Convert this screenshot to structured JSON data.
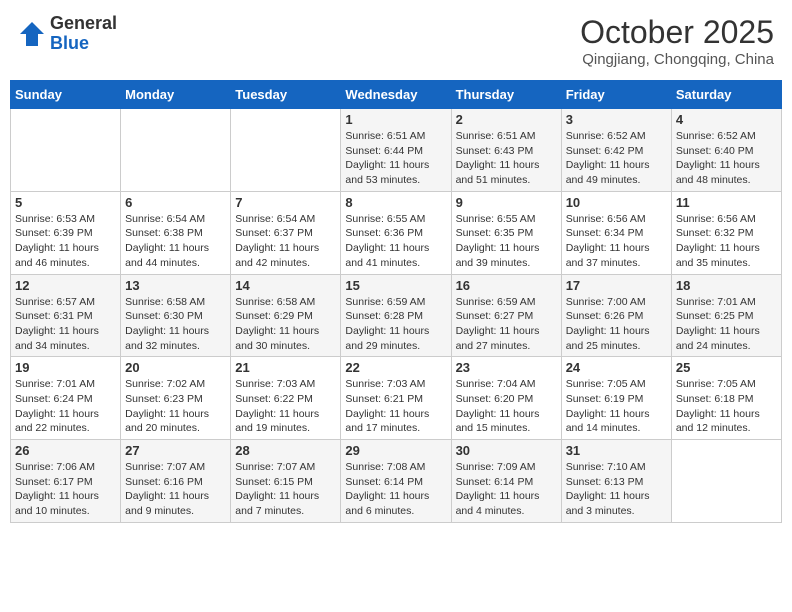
{
  "logo": {
    "general": "General",
    "blue": "Blue"
  },
  "header": {
    "title": "October 2025",
    "subtitle": "Qingjiang, Chongqing, China"
  },
  "weekdays": [
    "Sunday",
    "Monday",
    "Tuesday",
    "Wednesday",
    "Thursday",
    "Friday",
    "Saturday"
  ],
  "weeks": [
    [
      {
        "day": "",
        "info": ""
      },
      {
        "day": "",
        "info": ""
      },
      {
        "day": "",
        "info": ""
      },
      {
        "day": "1",
        "info": "Sunrise: 6:51 AM\nSunset: 6:44 PM\nDaylight: 11 hours\nand 53 minutes."
      },
      {
        "day": "2",
        "info": "Sunrise: 6:51 AM\nSunset: 6:43 PM\nDaylight: 11 hours\nand 51 minutes."
      },
      {
        "day": "3",
        "info": "Sunrise: 6:52 AM\nSunset: 6:42 PM\nDaylight: 11 hours\nand 49 minutes."
      },
      {
        "day": "4",
        "info": "Sunrise: 6:52 AM\nSunset: 6:40 PM\nDaylight: 11 hours\nand 48 minutes."
      }
    ],
    [
      {
        "day": "5",
        "info": "Sunrise: 6:53 AM\nSunset: 6:39 PM\nDaylight: 11 hours\nand 46 minutes."
      },
      {
        "day": "6",
        "info": "Sunrise: 6:54 AM\nSunset: 6:38 PM\nDaylight: 11 hours\nand 44 minutes."
      },
      {
        "day": "7",
        "info": "Sunrise: 6:54 AM\nSunset: 6:37 PM\nDaylight: 11 hours\nand 42 minutes."
      },
      {
        "day": "8",
        "info": "Sunrise: 6:55 AM\nSunset: 6:36 PM\nDaylight: 11 hours\nand 41 minutes."
      },
      {
        "day": "9",
        "info": "Sunrise: 6:55 AM\nSunset: 6:35 PM\nDaylight: 11 hours\nand 39 minutes."
      },
      {
        "day": "10",
        "info": "Sunrise: 6:56 AM\nSunset: 6:34 PM\nDaylight: 11 hours\nand 37 minutes."
      },
      {
        "day": "11",
        "info": "Sunrise: 6:56 AM\nSunset: 6:32 PM\nDaylight: 11 hours\nand 35 minutes."
      }
    ],
    [
      {
        "day": "12",
        "info": "Sunrise: 6:57 AM\nSunset: 6:31 PM\nDaylight: 11 hours\nand 34 minutes."
      },
      {
        "day": "13",
        "info": "Sunrise: 6:58 AM\nSunset: 6:30 PM\nDaylight: 11 hours\nand 32 minutes."
      },
      {
        "day": "14",
        "info": "Sunrise: 6:58 AM\nSunset: 6:29 PM\nDaylight: 11 hours\nand 30 minutes."
      },
      {
        "day": "15",
        "info": "Sunrise: 6:59 AM\nSunset: 6:28 PM\nDaylight: 11 hours\nand 29 minutes."
      },
      {
        "day": "16",
        "info": "Sunrise: 6:59 AM\nSunset: 6:27 PM\nDaylight: 11 hours\nand 27 minutes."
      },
      {
        "day": "17",
        "info": "Sunrise: 7:00 AM\nSunset: 6:26 PM\nDaylight: 11 hours\nand 25 minutes."
      },
      {
        "day": "18",
        "info": "Sunrise: 7:01 AM\nSunset: 6:25 PM\nDaylight: 11 hours\nand 24 minutes."
      }
    ],
    [
      {
        "day": "19",
        "info": "Sunrise: 7:01 AM\nSunset: 6:24 PM\nDaylight: 11 hours\nand 22 minutes."
      },
      {
        "day": "20",
        "info": "Sunrise: 7:02 AM\nSunset: 6:23 PM\nDaylight: 11 hours\nand 20 minutes."
      },
      {
        "day": "21",
        "info": "Sunrise: 7:03 AM\nSunset: 6:22 PM\nDaylight: 11 hours\nand 19 minutes."
      },
      {
        "day": "22",
        "info": "Sunrise: 7:03 AM\nSunset: 6:21 PM\nDaylight: 11 hours\nand 17 minutes."
      },
      {
        "day": "23",
        "info": "Sunrise: 7:04 AM\nSunset: 6:20 PM\nDaylight: 11 hours\nand 15 minutes."
      },
      {
        "day": "24",
        "info": "Sunrise: 7:05 AM\nSunset: 6:19 PM\nDaylight: 11 hours\nand 14 minutes."
      },
      {
        "day": "25",
        "info": "Sunrise: 7:05 AM\nSunset: 6:18 PM\nDaylight: 11 hours\nand 12 minutes."
      }
    ],
    [
      {
        "day": "26",
        "info": "Sunrise: 7:06 AM\nSunset: 6:17 PM\nDaylight: 11 hours\nand 10 minutes."
      },
      {
        "day": "27",
        "info": "Sunrise: 7:07 AM\nSunset: 6:16 PM\nDaylight: 11 hours\nand 9 minutes."
      },
      {
        "day": "28",
        "info": "Sunrise: 7:07 AM\nSunset: 6:15 PM\nDaylight: 11 hours\nand 7 minutes."
      },
      {
        "day": "29",
        "info": "Sunrise: 7:08 AM\nSunset: 6:14 PM\nDaylight: 11 hours\nand 6 minutes."
      },
      {
        "day": "30",
        "info": "Sunrise: 7:09 AM\nSunset: 6:14 PM\nDaylight: 11 hours\nand 4 minutes."
      },
      {
        "day": "31",
        "info": "Sunrise: 7:10 AM\nSunset: 6:13 PM\nDaylight: 11 hours\nand 3 minutes."
      },
      {
        "day": "",
        "info": ""
      }
    ]
  ]
}
